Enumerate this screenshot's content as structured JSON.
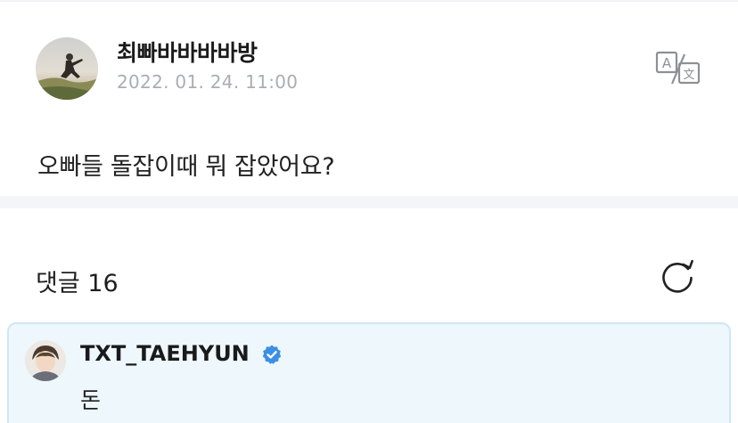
{
  "post": {
    "author": "최빠바바바바방",
    "date": "2022. 01. 24. 11:00",
    "content": "오빠들 돌잡이때 뭐 잡았어요?",
    "translate_icon": "translate-icon"
  },
  "comments": {
    "title": "댓글 16",
    "refresh_icon": "refresh-icon",
    "items": [
      {
        "author": "TXT_TAEHYUN",
        "verified": true,
        "text": "돈"
      }
    ]
  },
  "colors": {
    "date": "#a9adb5",
    "separator": "#f4f5f8",
    "comment_bg": "#eef7fc",
    "comment_border": "#cfe7f3",
    "verified": "#3b8fe4"
  }
}
